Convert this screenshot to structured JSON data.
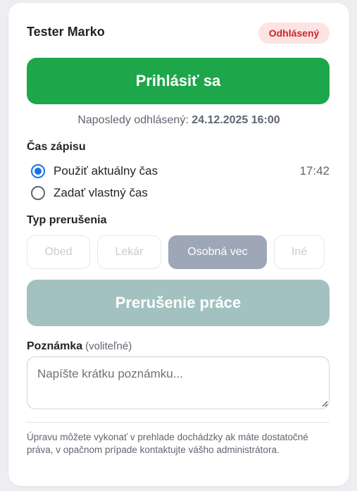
{
  "header": {
    "user_name": "Tester Marko",
    "status_badge": "Odhlásený"
  },
  "login_button_label": "Prihlásiť sa",
  "last_logout": {
    "prefix": "Naposledy odhlásený:",
    "value": "24.12.2025 16:00"
  },
  "time_section": {
    "title": "Čas zápisu",
    "options": [
      {
        "label": "Použiť aktuálny čas",
        "checked": true
      },
      {
        "label": "Zadať vlastný čas",
        "checked": false
      }
    ],
    "current_time": "17:42"
  },
  "break_type": {
    "title": "Typ prerušenia",
    "options": [
      "Obed",
      "Lekár",
      "Osobná vec",
      "Iné"
    ],
    "selected": "Osobná vec"
  },
  "break_button_label": "Prerušenie práce",
  "note": {
    "label": "Poznámka",
    "optional": "(voliteľné)",
    "placeholder": "Napíšte krátku poznámku...",
    "value": ""
  },
  "footer_text": "Úpravu môžete vykonať v prehlade dochádzky ak máte dostatočné práva, v opačnom prípade kontaktujte vášho administrátora.",
  "colors": {
    "login_button": "#1ea64b",
    "break_button_disabled": "#a3c1c1",
    "status_badge_bg": "#fde3e3",
    "status_badge_text": "#c62828",
    "radio_accent": "#1a73e8",
    "chip_selected": "#9ea7b8"
  }
}
